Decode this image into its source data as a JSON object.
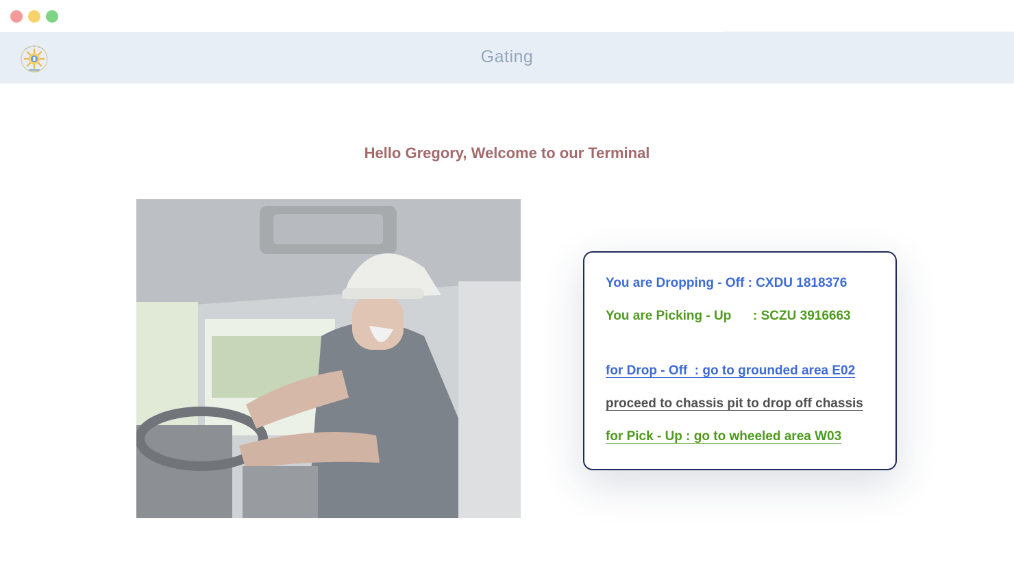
{
  "window": {
    "controls": [
      "close",
      "minimize",
      "maximize"
    ]
  },
  "header": {
    "title": "Gating",
    "logo_icon": "port-logo-icon"
  },
  "welcome": {
    "text": "Hello Gregory, Welcome to our Terminal"
  },
  "photo": {
    "icon": "truck-driver-photo"
  },
  "card": {
    "dropping_line": "You are Dropping - Off : CXDU 1818376",
    "picking_line": "You are Picking - Up      : SCZU 3916663",
    "drop_instruction": "for Drop - Off  : go to grounded area E02",
    "chassis_instruction": "proceed to chassis pit to drop off chassis",
    "pick_instruction": "for Pick - Up : go to wheeled area W03"
  },
  "colors": {
    "header_bg": "#e8eef6",
    "header_text": "#94a6bd",
    "welcome_text": "#a46a6c",
    "drop_blue": "#3d6ad6",
    "pick_green": "#4f9a1f",
    "card_border": "#1f2a5a"
  }
}
